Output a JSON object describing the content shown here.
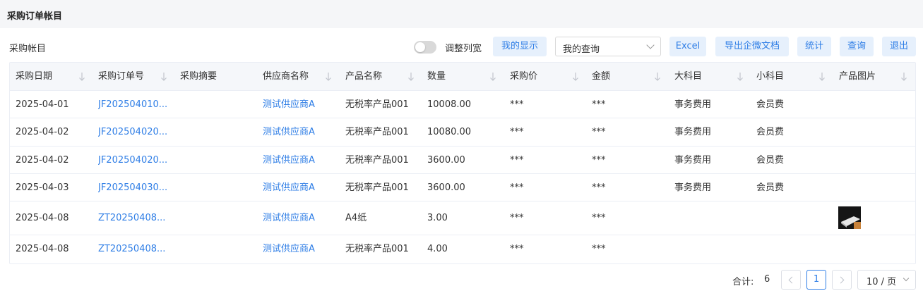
{
  "page": {
    "title": "采购订单帐目"
  },
  "toolbar": {
    "label": "采购帐目",
    "toggle_label": "调整列宽",
    "toggle_on": false,
    "buttons": {
      "my_display": "我的显示",
      "excel": "Excel",
      "export_wecom": "导出企微文档",
      "stats": "统计",
      "query": "查询",
      "exit": "退出"
    },
    "select": {
      "value": "我的查询"
    }
  },
  "table": {
    "columns": [
      "采购日期",
      "采购订单号",
      "采购摘要",
      "供应商名称",
      "产品名称",
      "数量",
      "采购价",
      "金额",
      "大科目",
      "小科目",
      "产品图片"
    ],
    "rows": [
      {
        "date": "2025-04-01",
        "order_no": "JF202504010...",
        "summary": "",
        "supplier": "测试供应商A",
        "product": "无税率产品001",
        "qty": "10008.00",
        "price": "***",
        "amount": "***",
        "major": "事务费用",
        "minor": "会员费",
        "has_image": false
      },
      {
        "date": "2025-04-02",
        "order_no": "JF202504020...",
        "summary": "",
        "supplier": "测试供应商A",
        "product": "无税率产品001",
        "qty": "10080.00",
        "price": "***",
        "amount": "***",
        "major": "事务费用",
        "minor": "会员费",
        "has_image": false
      },
      {
        "date": "2025-04-02",
        "order_no": "JF202504020...",
        "summary": "",
        "supplier": "测试供应商A",
        "product": "无税率产品001",
        "qty": "3600.00",
        "price": "***",
        "amount": "***",
        "major": "事务费用",
        "minor": "会员费",
        "has_image": false
      },
      {
        "date": "2025-04-03",
        "order_no": "JF202504030...",
        "summary": "",
        "supplier": "测试供应商A",
        "product": "无税率产品001",
        "qty": "3600.00",
        "price": "***",
        "amount": "***",
        "major": "事务费用",
        "minor": "会员费",
        "has_image": false
      },
      {
        "date": "2025-04-08",
        "order_no": "ZT20250408...",
        "summary": "",
        "supplier": "测试供应商A",
        "product": "A4纸",
        "qty": "3.00",
        "price": "***",
        "amount": "***",
        "major": "",
        "minor": "",
        "has_image": true
      },
      {
        "date": "2025-04-08",
        "order_no": "ZT20250408...",
        "summary": "",
        "supplier": "测试供应商A",
        "product": "无税率产品001",
        "qty": "4.00",
        "price": "***",
        "amount": "***",
        "major": "",
        "minor": "",
        "has_image": false
      }
    ]
  },
  "pagination": {
    "total_label": "合计:",
    "total": "6",
    "current_page": "1",
    "page_size": "10 / 页"
  },
  "colors": {
    "accent": "#2f7ee6",
    "button_bg": "#e6f0fc",
    "header_bg": "#f5f7fa",
    "titlebar_bg": "#f5f6f8"
  },
  "icons": {
    "sort": "arrow-down-icon",
    "prev": "chevron-left-icon",
    "next": "chevron-right-icon",
    "dropdown": "chevron-down-icon"
  }
}
